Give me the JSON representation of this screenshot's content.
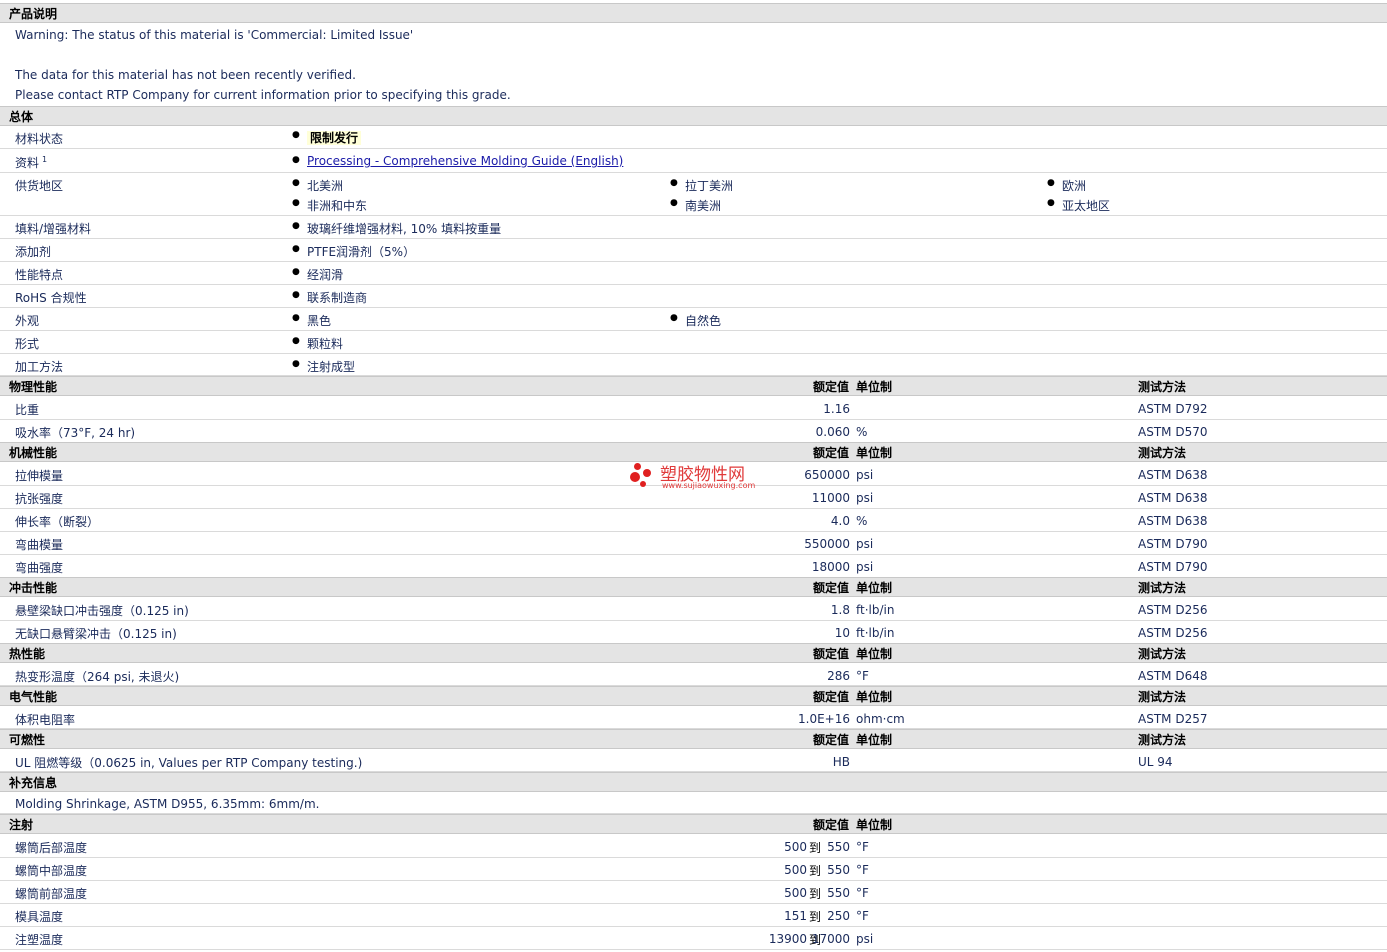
{
  "product": {
    "header": "产品说明",
    "warning": "Warning: The status of this material is 'Commercial: Limited Issue'",
    "note1": "The data for this material has not been recently verified.",
    "note2": "Please contact RTP Company for current information prior to specifying this grade."
  },
  "general": {
    "header": "总体",
    "status_label": "材料状态",
    "status_value": "限制发行",
    "docs_label": "资料",
    "docs_sup": "1",
    "docs_link": "Processing - Comprehensive Molding Guide (English)",
    "regions_label": "供货地区",
    "regions": [
      "北美洲",
      "拉丁美洲",
      "欧洲",
      "非洲和中东",
      "南美洲",
      "亚太地区"
    ],
    "filler_label": "填料/增强材料",
    "filler_value": "玻璃纤维增强材料, 10% 填料按重量",
    "additive_label": "添加剂",
    "additive_value": "PTFE润滑剂（5%）",
    "features_label": "性能特点",
    "features_value": "经润滑",
    "rohs_label": "RoHS 合规性",
    "rohs_value": "联系制造商",
    "appearance_label": "外观",
    "appearance_values": [
      "黑色",
      "自然色"
    ],
    "form_label": "形式",
    "form_value": "颗粒料",
    "process_label": "加工方法",
    "process_value": "注射成型"
  },
  "columns": {
    "value": "额定值",
    "unit": "单位制",
    "test": "测试方法"
  },
  "physical": {
    "header": "物理性能",
    "rows": [
      {
        "name": "比重",
        "value": "1.16",
        "unit": "",
        "test": "ASTM D792"
      },
      {
        "name": "吸水率（73°F, 24 hr)",
        "value": "0.060",
        "unit": "%",
        "test": "ASTM D570"
      }
    ]
  },
  "mechanical": {
    "header": "机械性能",
    "rows": [
      {
        "name": "拉伸模量",
        "value": "650000",
        "unit": "psi",
        "test": "ASTM D638"
      },
      {
        "name": "抗张强度",
        "value": "11000",
        "unit": "psi",
        "test": "ASTM D638"
      },
      {
        "name": "伸长率（断裂）",
        "value": "4.0",
        "unit": "%",
        "test": "ASTM D638"
      },
      {
        "name": "弯曲模量",
        "value": "550000",
        "unit": "psi",
        "test": "ASTM D790"
      },
      {
        "name": "弯曲强度",
        "value": "18000",
        "unit": "psi",
        "test": "ASTM D790"
      }
    ]
  },
  "impact": {
    "header": "冲击性能",
    "rows": [
      {
        "name": "悬壁梁缺口冲击强度（0.125 in)",
        "value": "1.8",
        "unit": "ft·lb/in",
        "test": "ASTM D256"
      },
      {
        "name": "无缺口悬臂梁冲击（0.125 in)",
        "value": "10",
        "unit": "ft·lb/in",
        "test": "ASTM D256"
      }
    ]
  },
  "thermal": {
    "header": "热性能",
    "rows": [
      {
        "name": "热变形温度（264 psi, 未退火)",
        "value": "286",
        "unit": "°F",
        "test": "ASTM D648"
      }
    ]
  },
  "electrical": {
    "header": "电气性能",
    "rows": [
      {
        "name": "体积电阻率",
        "value": "1.0E+16",
        "unit": "ohm·cm",
        "test": "ASTM D257"
      }
    ]
  },
  "flammability": {
    "header": "可燃性",
    "rows": [
      {
        "name": "UL 阻燃等级（0.0625 in, Values per RTP Company testing.)",
        "value": "HB",
        "unit": "",
        "test": "UL 94"
      }
    ]
  },
  "supplement": {
    "header": "补充信息",
    "text": "Molding Shrinkage, ASTM D955, 6.35mm: 6mm/m."
  },
  "injection": {
    "header": "注射",
    "to": "到",
    "rows": [
      {
        "name": "螺筒后部温度",
        "low": "500",
        "high": "550",
        "unit": "°F"
      },
      {
        "name": "螺筒中部温度",
        "low": "500",
        "high": "550",
        "unit": "°F"
      },
      {
        "name": "螺筒前部温度",
        "low": "500",
        "high": "550",
        "unit": "°F"
      },
      {
        "name": "模具温度",
        "low": "151",
        "high": "250",
        "unit": "°F"
      },
      {
        "name": "注塑温度",
        "low": "13900",
        "high": "17000",
        "unit": "psi"
      }
    ]
  },
  "watermark": {
    "title": "塑胶物性网",
    "url": "www.sujiaowuxing.com"
  }
}
